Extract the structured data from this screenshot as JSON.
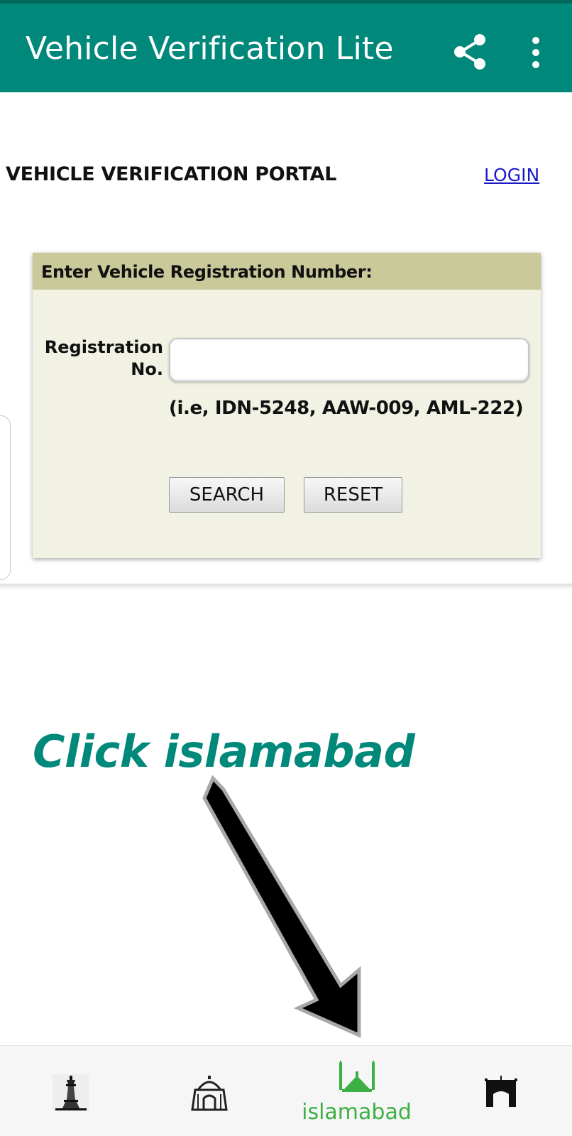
{
  "app_bar": {
    "title": "Vehicle Verification Lite",
    "share_icon": "share-icon",
    "more_icon": "more-vert-icon",
    "background": "#00897b"
  },
  "portal": {
    "title": "VEHICLE VERIFICATION PORTAL",
    "login_label": "LOGIN"
  },
  "form": {
    "header": "Enter Vehicle Registration Number:",
    "reg_label_line1": "Registration",
    "reg_label_line2": "No.",
    "reg_value": "",
    "reg_placeholder": "",
    "example": "(i.e, IDN-5248, AAW-009, AML-222)",
    "search_label": "SEARCH",
    "reset_label": "RESET"
  },
  "annotation": {
    "text": "Click islamabad",
    "arrow_icon": "arrow-down-right-icon",
    "color": "#00897b"
  },
  "bottom_nav": {
    "items": [
      {
        "icon": "minar-tower-icon",
        "label": "",
        "active": false
      },
      {
        "icon": "mausoleum-icon",
        "label": "",
        "active": false
      },
      {
        "icon": "mosque-icon",
        "label": "islamabad",
        "active": true
      },
      {
        "icon": "gate-icon",
        "label": "",
        "active": false
      }
    ],
    "active_color": "#3cb043"
  }
}
